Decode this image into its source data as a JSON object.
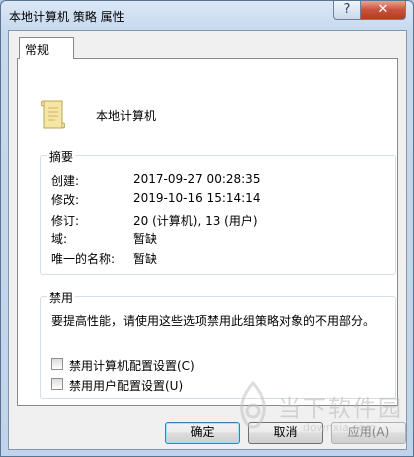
{
  "window": {
    "title": "本地计算机 策略 属性",
    "help_label": "?",
    "close_label": "✕"
  },
  "tabs": [
    {
      "label": "常规",
      "selected": true
    }
  ],
  "policy": {
    "name": "本地计算机",
    "icon": "document-scroll-icon"
  },
  "summary": {
    "legend": "摘要",
    "rows": [
      {
        "label": "创建:",
        "value": "2017-09-27 00:28:35"
      },
      {
        "label": "修改:",
        "value": "2019-10-16 15:14:14"
      },
      {
        "label": "修订:",
        "value": "20 (计算机), 13 (用户)"
      },
      {
        "label": "域:",
        "value": "暂缺"
      },
      {
        "label": "唯一的名称:",
        "value": "暂缺"
      }
    ]
  },
  "disable": {
    "legend": "禁用",
    "description": "要提高性能，请使用这些选项禁用此组策略对象的不用部分。",
    "options": [
      {
        "label": "禁用计算机配置设置(C)",
        "checked": false
      },
      {
        "label": "禁用用户配置设置(U)",
        "checked": false
      }
    ]
  },
  "buttons": {
    "ok": "确定",
    "cancel": "取消",
    "apply": "应用(A)",
    "apply_enabled": false
  },
  "watermark": {
    "text": "当下软件园",
    "sub": "downxia.com"
  }
}
